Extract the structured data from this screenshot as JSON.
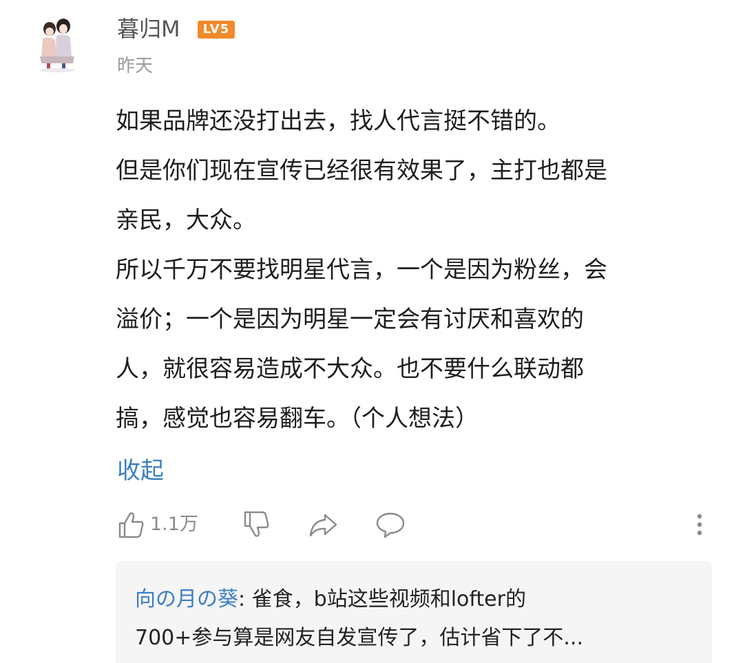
{
  "comment": {
    "username": "暮归M",
    "level_badge": "LV5",
    "timestamp": "昨天",
    "lines": [
      "如果品牌还没打出去，找人代言挺不错的。",
      "但是你们现在宣传已经很有效果了，主打也都是",
      "亲民，大众。",
      "所以千万不要找明星代言，一个是因为粉丝，会",
      "溢价；一个是因为明星一定会有讨厌和喜欢的",
      "人，就很容易造成不大众。也不要什么联动都",
      "搞，感觉也容易翻车。（个人想法）"
    ],
    "collapse_label": "收起"
  },
  "actions": {
    "like_count": "1.1万",
    "icons": [
      "thumbs-up-icon",
      "thumbs-down-icon",
      "share-icon",
      "comment-icon",
      "more-icon"
    ],
    "icon_color": "#8a8a8a"
  },
  "reply": {
    "author": "向の月の葵",
    "separator": ": ",
    "line1": "雀食，b站这些视频和lofter的",
    "line2": "700+参与算是网友自发宣传了，估计省下了不..."
  },
  "colors": {
    "link": "#3b7fc4",
    "badge": "#f08a2b",
    "reply_background": "#f5f5f5",
    "muted_text": "#9a9a9a"
  }
}
